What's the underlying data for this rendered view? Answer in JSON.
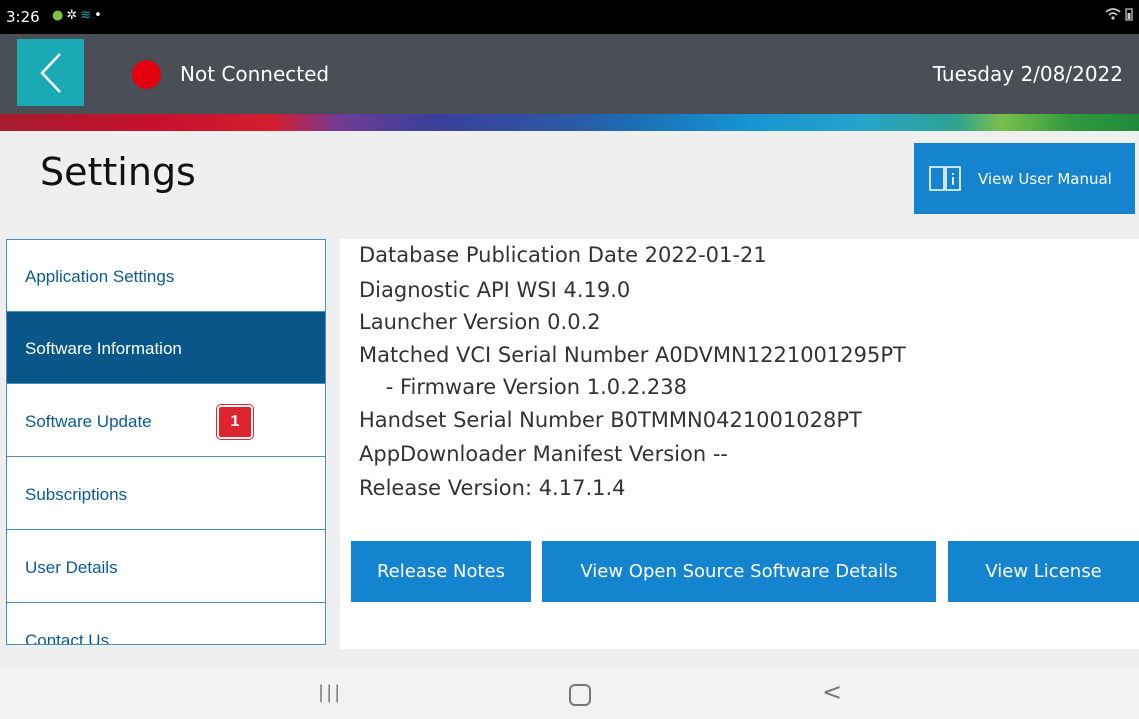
{
  "status_bar": {
    "time": "3:26",
    "icons": [
      "record-icon",
      "settings-icon",
      "app-icon",
      "dot-icon"
    ],
    "right_icons": [
      "wifi-icon",
      "battery-icon"
    ]
  },
  "header": {
    "connection_status": "Not Connected",
    "connection_color": "#e3000f",
    "date": "Tuesday 2/08/2022",
    "accent_color": "#19aab5"
  },
  "page": {
    "title": "Settings",
    "manual_button_label": "View User Manual"
  },
  "sidebar": {
    "items": [
      {
        "label": "Application Settings",
        "active": false
      },
      {
        "label": "Software Information",
        "active": true
      },
      {
        "label": "Software Update",
        "active": false,
        "badge": "1"
      },
      {
        "label": "Subscriptions",
        "active": false
      },
      {
        "label": "User Details",
        "active": false
      },
      {
        "label": "Contact Us",
        "active": false
      }
    ]
  },
  "info": {
    "lines": [
      "Database Publication Date 2022-01-21",
      "Diagnostic API WSI 4.19.0",
      "Launcher Version 0.0.2",
      "Matched VCI Serial Number A0DVMN1221001295PT",
      "    - Firmware Version 1.0.2.238",
      "Handset Serial Number B0TMMN0421001028PT",
      "AppDownloader Manifest Version --",
      "Release Version: 4.17.1.4"
    ]
  },
  "actions": {
    "release_notes": "Release Notes",
    "open_source": "View Open Source Software Details",
    "license": "View License"
  },
  "nav_bar": {
    "recent_symbol": "|||",
    "back_symbol": "<"
  }
}
